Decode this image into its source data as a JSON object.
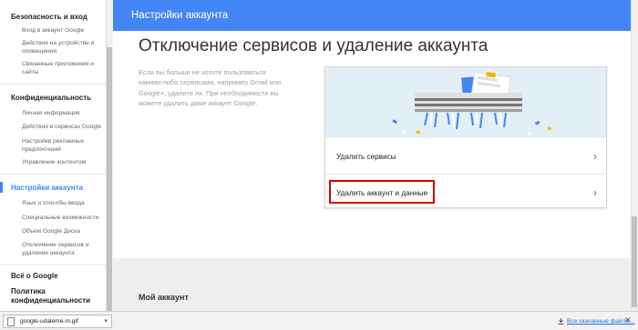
{
  "sidebar": {
    "sections": [
      {
        "label": "Безопасность и вход",
        "items": [
          "Вход в аккаунт Google",
          "Действия на устройстве и оповещения",
          "Связанные приложения и сайты"
        ]
      },
      {
        "label": "Конфиденциальность",
        "items": [
          "Личная информация",
          "Действия в сервисах Google",
          "Настройки рекламных предпочтений",
          "Управление контентом"
        ]
      },
      {
        "label": "Настройки аккаунта",
        "items": [
          "Язык и способы ввода",
          "Специальные возможности",
          "Объем Google Диска",
          "Отключение сервисов и удаление аккаунта"
        ],
        "active": true
      },
      {
        "label": "Всё о Google",
        "items": []
      },
      {
        "label": "Политика конфиденциальности",
        "items": []
      }
    ],
    "active_color": "#4285f4"
  },
  "header": {
    "title": "Настройки аккаунта",
    "color": "#4285f4"
  },
  "main": {
    "title": "Отключение сервисов и удаление аккаунта",
    "description": "Если вы больше не хотите пользоваться какими-либо сервисами, например Gmail или Google+, удалите их. При необходимости вы можете удалить даже аккаунт Google.",
    "options": [
      {
        "label": "Удалить сервисы",
        "icon": "chevron-right-icon"
      },
      {
        "label": "Удалить аккаунт и данные",
        "icon": "chevron-right-icon",
        "highlighted": true,
        "highlight_color": "#e00000"
      }
    ],
    "next_section": "Мой аккаунт"
  },
  "download_bar": {
    "file_name": "google-udaleme-m.gif",
    "show_all": "Все скачанные файлы...",
    "close_icon": "close-icon"
  }
}
